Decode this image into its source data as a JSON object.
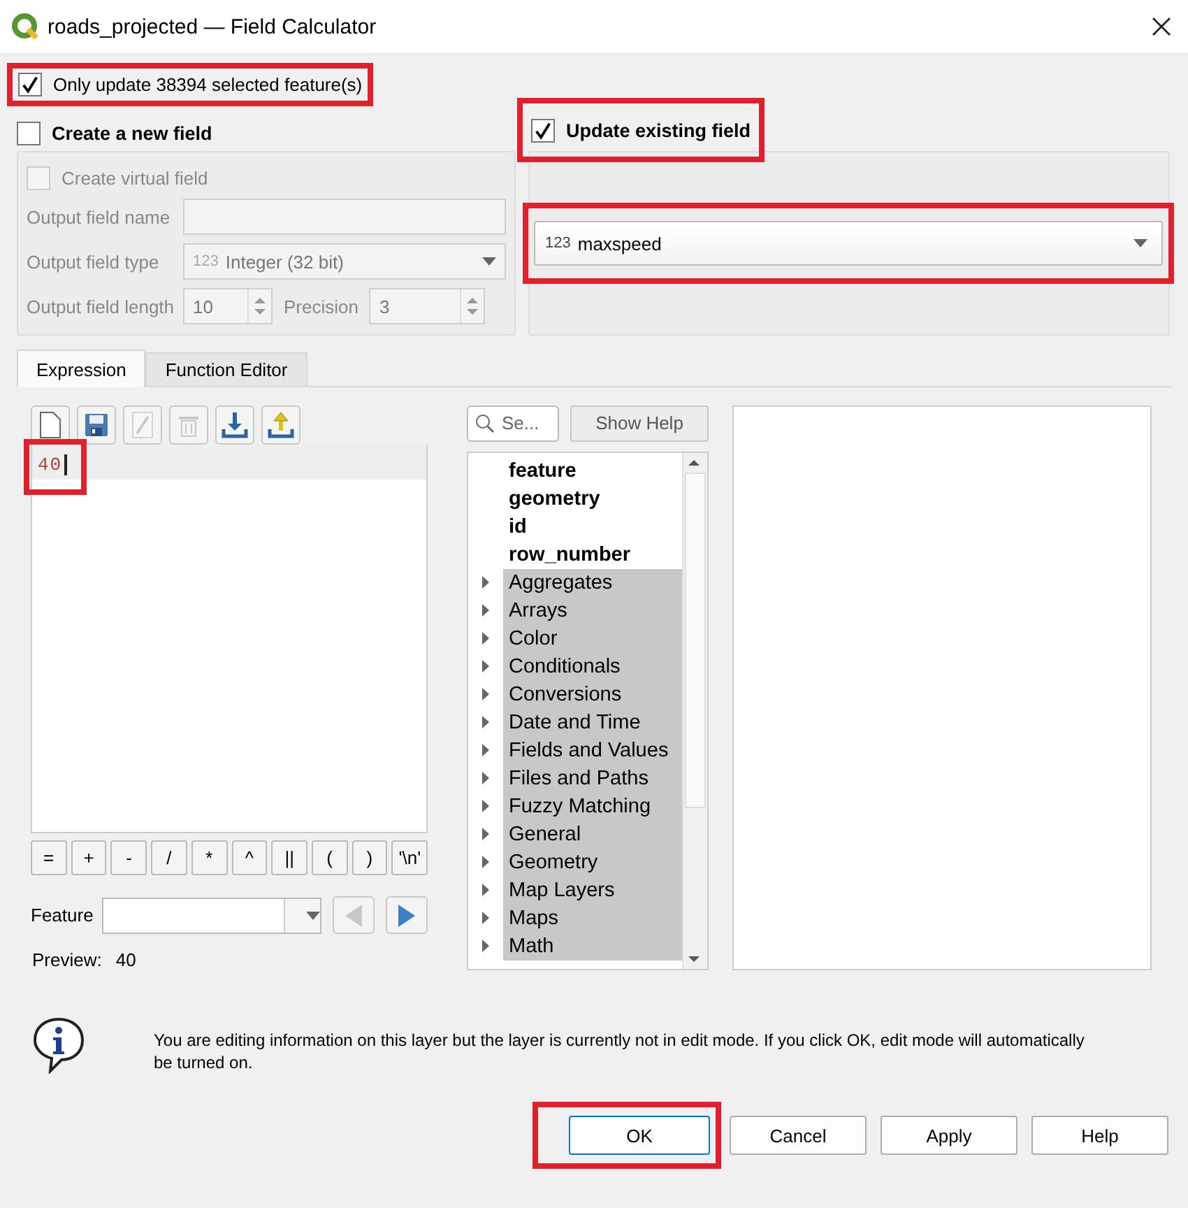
{
  "window": {
    "title": "roads_projected — Field Calculator"
  },
  "only_selected": {
    "label": "Only update 38394 selected feature(s)",
    "checked": true,
    "highlighted": true
  },
  "create_new_field": {
    "label": "Create a new field",
    "checked": false,
    "virtual_field": {
      "label": "Create virtual field",
      "checked": false
    },
    "output_name": {
      "label": "Output field name"
    },
    "output_type": {
      "label": "Output field type",
      "type_badge": "123",
      "value": "Integer (32 bit)"
    },
    "output_length": {
      "label": "Output field length",
      "value": "10"
    },
    "precision": {
      "label": "Precision",
      "value": "3"
    }
  },
  "update_existing": {
    "label": "Update existing field",
    "checked": true,
    "highlighted": true,
    "field": {
      "type_badge": "123",
      "value": "maxspeed",
      "highlighted": true
    }
  },
  "tabs": [
    {
      "label": "Expression",
      "selected": true
    },
    {
      "label": "Function Editor",
      "selected": false
    }
  ],
  "toolbar": [
    {
      "kind": "new",
      "disabled": false
    },
    {
      "kind": "save",
      "disabled": false
    },
    {
      "kind": "edit",
      "disabled": true
    },
    {
      "kind": "delete",
      "disabled": true
    },
    {
      "kind": "import",
      "disabled": false
    },
    {
      "kind": "export",
      "disabled": false
    }
  ],
  "expression": {
    "text": "40",
    "highlighted": true
  },
  "operators": [
    "=",
    "+",
    "-",
    "/",
    "*",
    "^",
    "||",
    "(",
    ")",
    "'\\n'"
  ],
  "feature": {
    "label": "Feature"
  },
  "preview": {
    "label": "Preview:",
    "value": "40"
  },
  "search": {
    "placeholder": "Se..."
  },
  "show_help": "Show Help",
  "functions": [
    {
      "label": "feature",
      "kind": "variable"
    },
    {
      "label": "geometry",
      "kind": "variable"
    },
    {
      "label": "id",
      "kind": "variable"
    },
    {
      "label": "row_number",
      "kind": "variable"
    },
    {
      "label": "Aggregates",
      "kind": "group"
    },
    {
      "label": "Arrays",
      "kind": "group"
    },
    {
      "label": "Color",
      "kind": "group"
    },
    {
      "label": "Conditionals",
      "kind": "group"
    },
    {
      "label": "Conversions",
      "kind": "group"
    },
    {
      "label": "Date and Time",
      "kind": "group"
    },
    {
      "label": "Fields and Values",
      "kind": "group"
    },
    {
      "label": "Files and Paths",
      "kind": "group"
    },
    {
      "label": "Fuzzy Matching",
      "kind": "group"
    },
    {
      "label": "General",
      "kind": "group"
    },
    {
      "label": "Geometry",
      "kind": "group"
    },
    {
      "label": "Map Layers",
      "kind": "group"
    },
    {
      "label": "Maps",
      "kind": "group"
    },
    {
      "label": "Math",
      "kind": "group"
    }
  ],
  "info": "You are editing information on this layer but the layer is currently not in edit mode. If you click OK, edit mode will automatically be turned on.",
  "buttons": [
    {
      "label": "OK",
      "highlighted": true
    },
    {
      "label": "Cancel",
      "highlighted": false
    },
    {
      "label": "Apply",
      "highlighted": false
    },
    {
      "label": "Help",
      "highlighted": false
    }
  ]
}
